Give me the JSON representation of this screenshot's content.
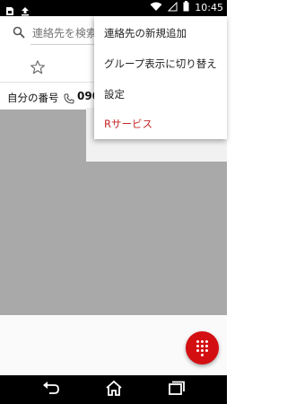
{
  "status_bar": {
    "time": "10:45",
    "icons": [
      "sim-card-icon",
      "upload-icon",
      "wifi-icon",
      "signal-off-icon",
      "battery-icon"
    ]
  },
  "search": {
    "placeholder": "連絡先を検索"
  },
  "tabs": {
    "items": [
      {
        "name": "favorites",
        "icon": "star-outline-icon"
      }
    ]
  },
  "profile": {
    "label": "自分の番号",
    "number": "090"
  },
  "overflow_menu": {
    "items": [
      {
        "label": "連絡先の新規追加",
        "accent": false
      },
      {
        "label": "グループ表示に切り替え",
        "accent": false
      },
      {
        "label": "設定",
        "accent": false
      },
      {
        "label": "Rサービス",
        "accent": true
      }
    ]
  },
  "fab": {
    "icon": "dialpad-icon",
    "color": "#d40f12"
  },
  "colors": {
    "accent_red": "#c62828",
    "overlay_gray": "#a9a9a9",
    "status_bar": "#000000"
  },
  "nav_bar": {
    "buttons": [
      "back-icon",
      "home-icon",
      "recent-apps-icon"
    ]
  }
}
